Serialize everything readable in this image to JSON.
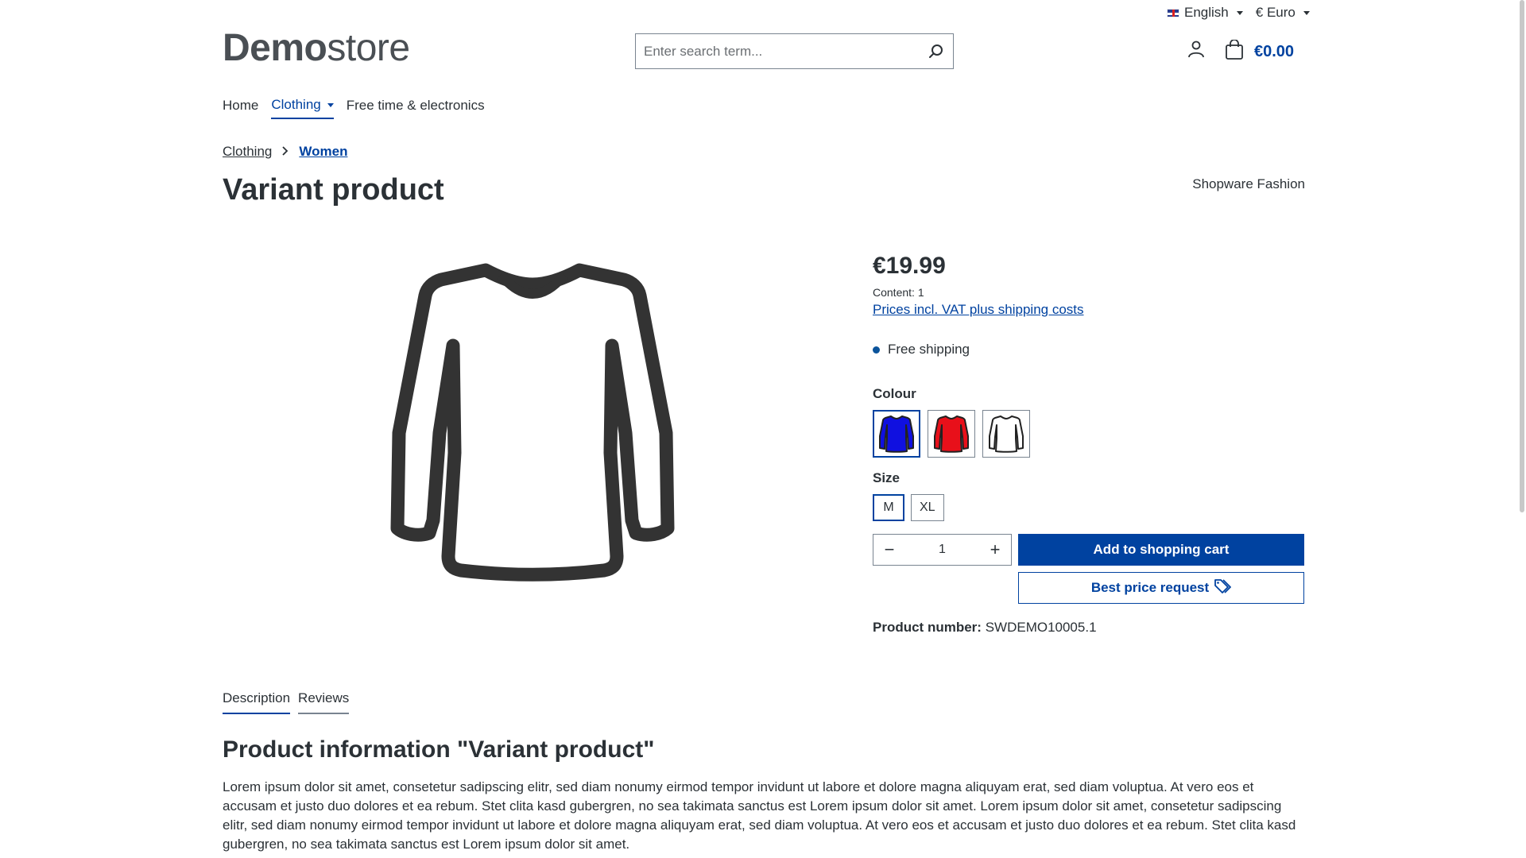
{
  "top_bar": {
    "language": "English",
    "currency": "€ Euro"
  },
  "logo": {
    "bold": "Demo",
    "light": "store"
  },
  "search": {
    "placeholder": "Enter search term..."
  },
  "header": {
    "cart_total": "€0.00"
  },
  "nav": {
    "items": [
      {
        "label": "Home"
      },
      {
        "label": "Clothing"
      },
      {
        "label": "Free time & electronics"
      }
    ]
  },
  "breadcrumb": {
    "items": [
      {
        "label": "Clothing"
      },
      {
        "label": "Women"
      }
    ]
  },
  "product": {
    "title": "Variant product",
    "manufacturer": "Shopware Fashion",
    "price": "€19.99",
    "content": "Content: 1",
    "vat_link": "Prices incl. VAT plus shipping costs",
    "shipping": "Free shipping",
    "colour_label": "Colour",
    "colours": [
      {
        "name": "blue",
        "color": "#1010e0"
      },
      {
        "name": "red",
        "color": "#e8101a"
      },
      {
        "name": "white",
        "color": "#ffffff"
      }
    ],
    "size_label": "Size",
    "sizes": [
      {
        "label": "M"
      },
      {
        "label": "XL"
      }
    ],
    "quantity": "1",
    "add_to_cart": "Add to shopping cart",
    "best_price": "Best price request",
    "product_number_label": "Product number:",
    "product_number": "SWDEMO10005.1"
  },
  "tabs": [
    {
      "label": "Description"
    },
    {
      "label": "Reviews"
    }
  ],
  "description": {
    "title": "Product information \"Variant product\"",
    "text": "Lorem ipsum dolor sit amet, consetetur sadipscing elitr, sed diam nonumy eirmod tempor invidunt ut labore et dolore magna aliquyam erat, sed diam voluptua. At vero eos et accusam et justo duo dolores et ea rebum. Stet clita kasd gubergren, no sea takimata sanctus est Lorem ipsum dolor sit amet. Lorem ipsum dolor sit amet, consetetur sadipscing elitr, sed diam nonumy eirmod tempor invidunt ut labore et dolore magna aliquyam erat, sed diam voluptua. At vero eos et accusam et justo duo dolores et ea rebum. Stet clita kasd gubergren, no sea takimata sanctus est Lorem ipsum dolor sit amet."
  },
  "colors": {
    "accent": "#0042a0",
    "text": "#2b3136",
    "border": "#798490"
  }
}
